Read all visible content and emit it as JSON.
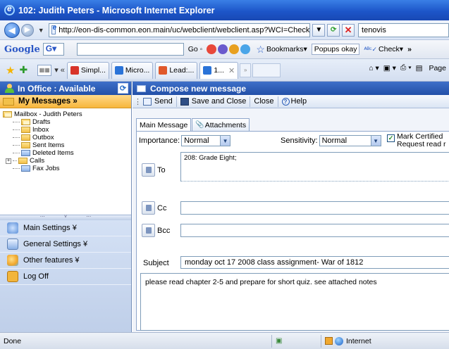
{
  "window": {
    "title": "102: Judith Peters - Microsoft Internet Explorer"
  },
  "address_bar": {
    "url": "http://eon-dis-common.eon.main/uc/webclient/webclient.asp?WCI=Check",
    "search_value": "tenovis"
  },
  "google_toolbar": {
    "logo": "Google",
    "logo_box": "G",
    "go_label": "Go",
    "bookmarks_label": "Bookmarks",
    "popups_label": "Popups okay",
    "check_label": "Check",
    "more_label": "»"
  },
  "tabs": {
    "items": [
      {
        "label": "Simpl..."
      },
      {
        "label": "Micro..."
      },
      {
        "label": "Lead:..."
      },
      {
        "label": "1..."
      }
    ],
    "page_label": "Page"
  },
  "sidebar": {
    "status": "In Office : Available",
    "my_messages": "My Messages »",
    "mailbox_root": "Mailbox - Judith Peters",
    "folders": [
      {
        "label": "Drafts"
      },
      {
        "label": "Inbox"
      },
      {
        "label": "Outbox"
      },
      {
        "label": "Sent Items"
      },
      {
        "label": "Deleted Items"
      },
      {
        "label": "Calls"
      },
      {
        "label": "Fax Jobs"
      }
    ],
    "nav": [
      {
        "label": "Main Settings ¥"
      },
      {
        "label": "General Settings ¥"
      },
      {
        "label": "Other features ¥"
      },
      {
        "label": "Log Off"
      }
    ]
  },
  "compose": {
    "title": "Compose new message",
    "actions": {
      "send": "Send",
      "save_close": "Save and Close",
      "close": "Close",
      "help": "Help"
    },
    "tabs": {
      "main": "Main Message",
      "attachments": "Attachments"
    },
    "importance_label": "Importance:",
    "importance_value": "Normal",
    "sensitivity_label": "Sensitivity:",
    "sensitivity_value": "Normal",
    "mark_certified": "Mark Certified",
    "request_read": "Request read r",
    "to_label": "To",
    "to_value": "208: Grade Eight;",
    "cc_label": "Cc",
    "bcc_label": "Bcc",
    "subject_label": "Subject",
    "subject_value": "monday oct 17 2008 class assignment- War of 1812",
    "body": "please read chapter 2-5 and prepare for short quiz. see attached notes"
  },
  "statusbar": {
    "left": "Done",
    "zone": "Internet"
  }
}
